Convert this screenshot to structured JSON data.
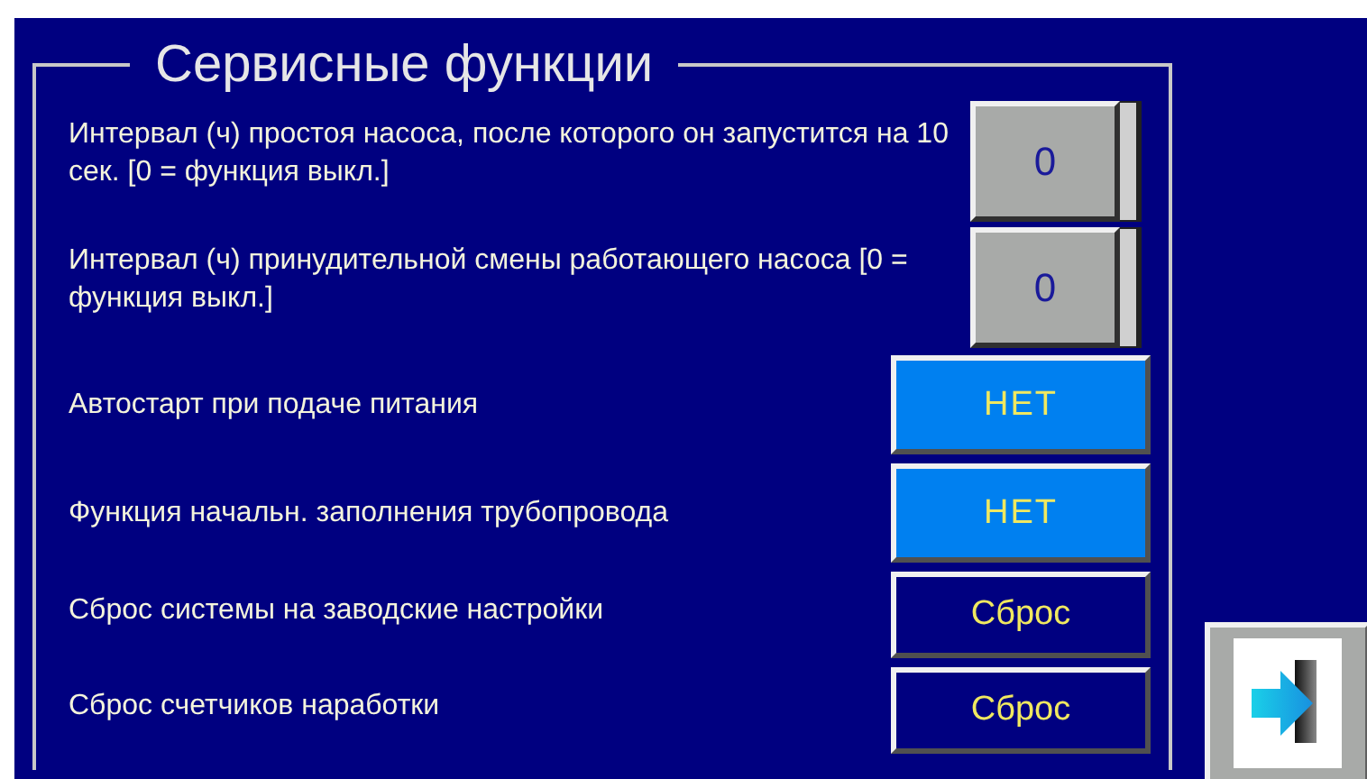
{
  "panel": {
    "title": "Сервисные функции"
  },
  "rows": [
    {
      "kind": "value_field",
      "label": "Интервал (ч) простоя насоса, после которого он запустится на 10 сек. [0 = функция выкл.]",
      "value": "0"
    },
    {
      "kind": "value_field",
      "label": "Интервал (ч) принудительной смены работающего насоса [0 = функция выкл.]",
      "value": "0"
    },
    {
      "kind": "toggle_button",
      "label": "Автостарт при подаче  питания",
      "value": "НЕТ"
    },
    {
      "kind": "toggle_button",
      "label": "Функция начальн. заполнения трубопровода",
      "value": "НЕТ"
    },
    {
      "kind": "action_button",
      "label": "Сброс системы на заводские настройки",
      "value": "Сброс"
    },
    {
      "kind": "action_button",
      "label": "Сброс счетчиков наработки",
      "value": "Сброс"
    }
  ]
}
